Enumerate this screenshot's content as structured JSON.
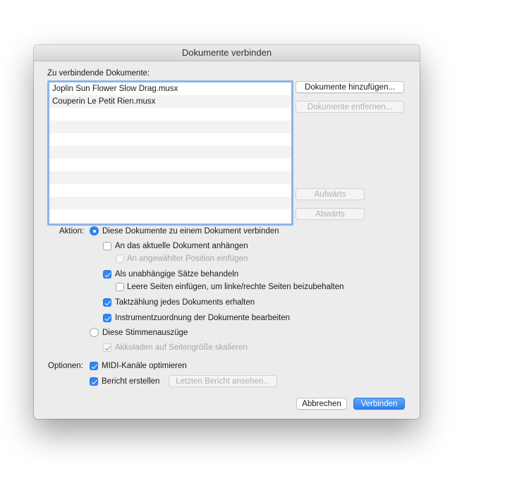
{
  "dialog": {
    "title": "Dokumente verbinden",
    "documents_label": "Zu verbindende Dokumente:",
    "documents": [
      "Joplin Sun Flower Slow Drag.musx",
      "Couperin Le Petit Rien.musx"
    ],
    "buttons": {
      "add": "Dokumente hinzufügen...",
      "remove": "Dokumente entfernen...",
      "up": "Aufwärts",
      "down": "Abwärts",
      "view_report": "Letzten Bericht ansehen...",
      "cancel": "Abbrechen",
      "combine": "Verbinden"
    },
    "action_label": "Aktion:",
    "action_combine": "Diese Dokumente zu einem Dokument verbinden",
    "append_current": "An das aktuelle Dokument anhängen",
    "insert_at_position": "An angewählter Position einfügen",
    "independent_movements": "Als unabhängige Sätze behandeln",
    "blank_pages": "Leere Seiten einfügen, um linke/rechte Seiten beizubehalten",
    "keep_measure_numbers": "Taktzählung jedes Dokuments erhalten",
    "edit_instrument_assignment": "Instrumentzuordnung der Dokumente bearbeiten",
    "action_parts": "Diese Stimmenauszüge",
    "scale_systems": "Akkoladen auf Seitengröße skalieren",
    "options_label": "Optionen:",
    "optimize_midi": "MIDI-Kanäle optimieren",
    "create_report": "Bericht erstellen"
  }
}
